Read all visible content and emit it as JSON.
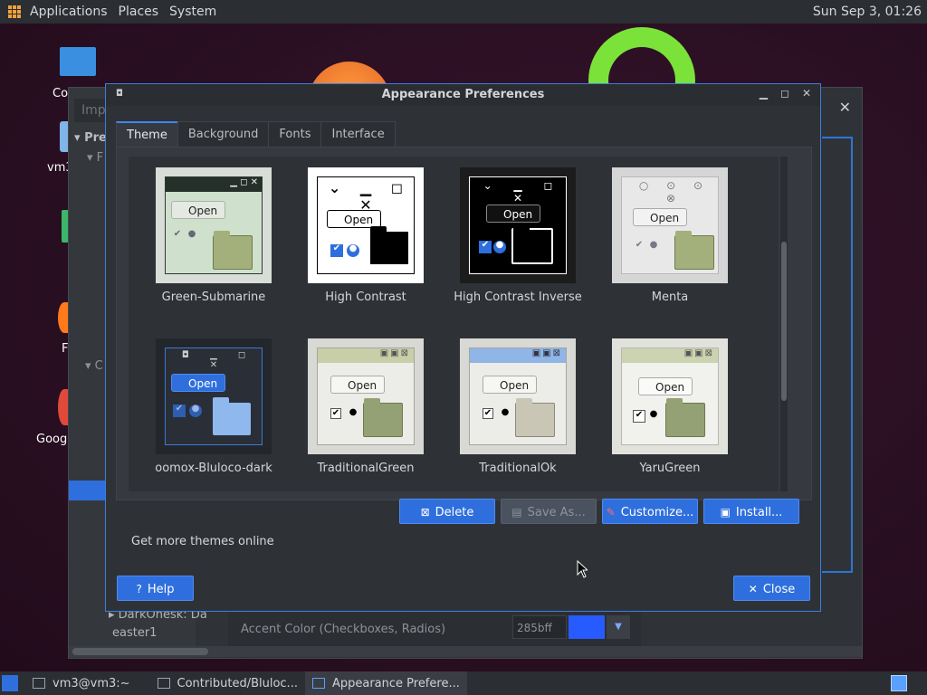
{
  "top_panel": {
    "menu": [
      "Applications",
      "Places",
      "System"
    ],
    "clock": "Sun Sep  3, 01:26"
  },
  "desktop": {
    "icons": [
      "Co",
      "vm3",
      "F",
      "Goog"
    ]
  },
  "back_window": {
    "search_placeholder": "Imp",
    "section": "Pres",
    "row_label": "F",
    "collapsed": "C",
    "list_items": [
      "DarkOnesk: Da",
      "easter1"
    ],
    "accent_label": "Accent Color (Checkboxes, Radios)",
    "accent_value": "285bff"
  },
  "dialog": {
    "title": "Appearance Preferences",
    "tabs": [
      "Theme",
      "Background",
      "Fonts",
      "Interface"
    ],
    "active_tab": "Theme",
    "themes": [
      {
        "name": "Green-Submarine"
      },
      {
        "name": "High Contrast"
      },
      {
        "name": "High Contrast Inverse"
      },
      {
        "name": "Menta"
      },
      {
        "name": "oomox-Bluloco-dark"
      },
      {
        "name": "TraditionalGreen"
      },
      {
        "name": "TraditionalOk"
      },
      {
        "name": "YaruGreen"
      }
    ],
    "thumb_open_label": "Open",
    "buttons": {
      "delete": "Delete",
      "save_as": "Save As...",
      "customize": "Customize...",
      "install": "Install..."
    },
    "get_more": "Get more themes online",
    "help": "Help",
    "close": "Close"
  },
  "taskbar": {
    "items": [
      "vm3@vm3:~",
      "Contributed/Bluloc...",
      "Appearance Prefere..."
    ]
  }
}
